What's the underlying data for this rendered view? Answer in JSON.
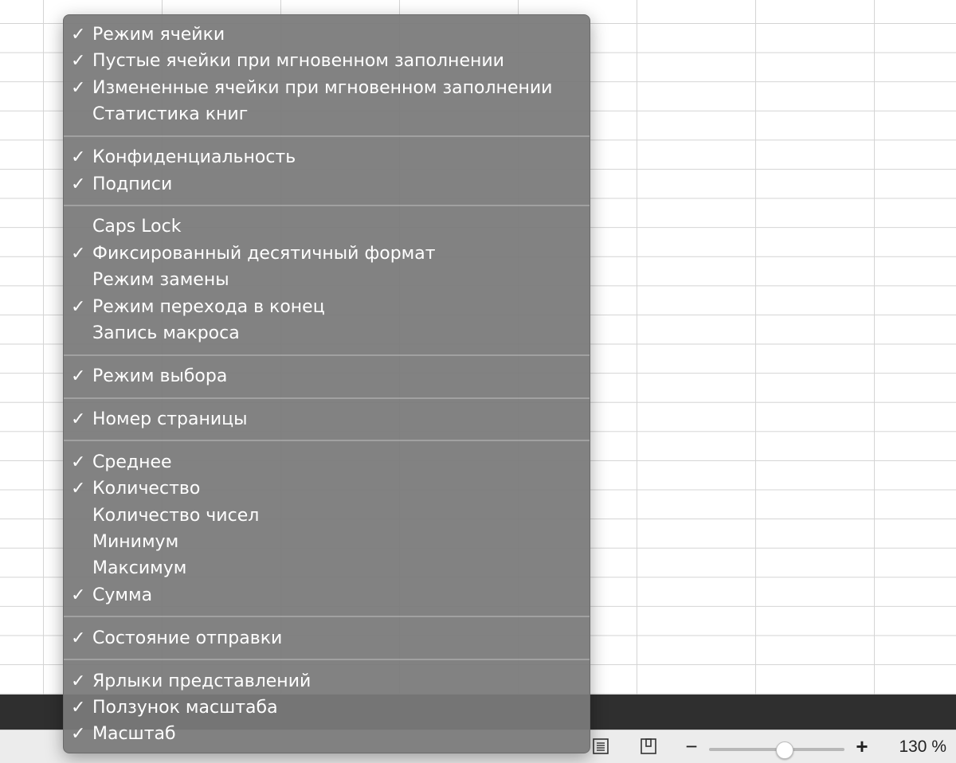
{
  "menu": {
    "groups": [
      [
        {
          "label": "Режим ячейки",
          "checked": true
        },
        {
          "label": "Пустые ячейки при мгновенном заполнении",
          "checked": true
        },
        {
          "label": "Измененные ячейки при мгновенном заполнении",
          "checked": true
        },
        {
          "label": "Статистика книг",
          "checked": false
        }
      ],
      [
        {
          "label": "Конфиденциальность",
          "checked": true
        },
        {
          "label": "Подписи",
          "checked": true
        }
      ],
      [
        {
          "label": "Caps Lock",
          "checked": false
        },
        {
          "label": "Фиксированный десятичный формат",
          "checked": true
        },
        {
          "label": "Режим замены",
          "checked": false
        },
        {
          "label": "Режим перехода в конец",
          "checked": true
        },
        {
          "label": "Запись макроса",
          "checked": false
        }
      ],
      [
        {
          "label": "Режим выбора",
          "checked": true
        }
      ],
      [
        {
          "label": "Номер страницы",
          "checked": true
        }
      ],
      [
        {
          "label": "Среднее",
          "checked": true
        },
        {
          "label": "Количество",
          "checked": true
        },
        {
          "label": "Количество чисел",
          "checked": false
        },
        {
          "label": "Минимум",
          "checked": false
        },
        {
          "label": "Максимум",
          "checked": false
        },
        {
          "label": "Сумма",
          "checked": true
        }
      ],
      [
        {
          "label": "Состояние отправки",
          "checked": true
        }
      ],
      [
        {
          "label": "Ярлыки представлений",
          "checked": true
        },
        {
          "label": "Ползунок масштаба",
          "checked": true
        },
        {
          "label": "Масштаб",
          "checked": true
        }
      ]
    ],
    "check_glyph": "✓"
  },
  "status_bar": {
    "zoom_out": "−",
    "zoom_in": "+",
    "zoom_level": "130 %",
    "zoom_slider_fraction": 0.55,
    "view_icons": [
      "page-layout-view-icon",
      "page-break-view-icon"
    ]
  },
  "colors": {
    "menu_background": "#7a7a7a",
    "menu_text": "#ffffff",
    "grid_line": "#d4d4d4",
    "dark_band": "#2f2f2f",
    "status_bar": "#ececec"
  }
}
